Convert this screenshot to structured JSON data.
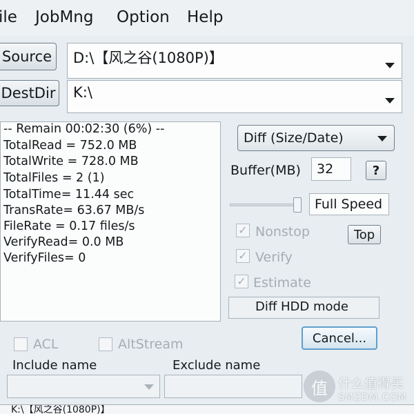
{
  "menu": [
    "ile",
    "JobMng",
    "Option",
    "Help"
  ],
  "source": {
    "button": "Source",
    "path": "D:\\【风之谷(1080P)】"
  },
  "dest": {
    "button": "DestDir",
    "path": "K:\\"
  },
  "status": [
    " -- Remain 00:02:30 (6%) --",
    "TotalRead = 752.0 MB",
    "TotalWrite = 728.0 MB",
    "TotalFiles = 2 (1)",
    "TotalTime= 11.44 sec",
    "TransRate= 63.67 MB/s",
    "FileRate  = 0.17 files/s",
    "VerifyRead= 0.0 MB",
    "VerifyFiles= 0"
  ],
  "mode": {
    "value": "Diff (Size/Date)"
  },
  "buffer": {
    "label": "Buffer(MB)",
    "value": "32",
    "help": "?"
  },
  "speed": {
    "label": "Full Speed"
  },
  "options": {
    "nonstop": "Nonstop",
    "verify": "Verify",
    "estimate": "Estimate",
    "top": "Top",
    "checked_mark": "✓"
  },
  "diff_hdd": "Diff HDD mode",
  "cancel": "Cancel...",
  "bottom": {
    "acl": "ACL",
    "altstream": "AltStream",
    "include": "Include name",
    "exclude": "Exclude name",
    "current_path": "K:\\【风之谷(1080P)】"
  },
  "watermark": {
    "logo": "值",
    "cn": "什么值得买",
    "en": "SMZDM.COM"
  }
}
